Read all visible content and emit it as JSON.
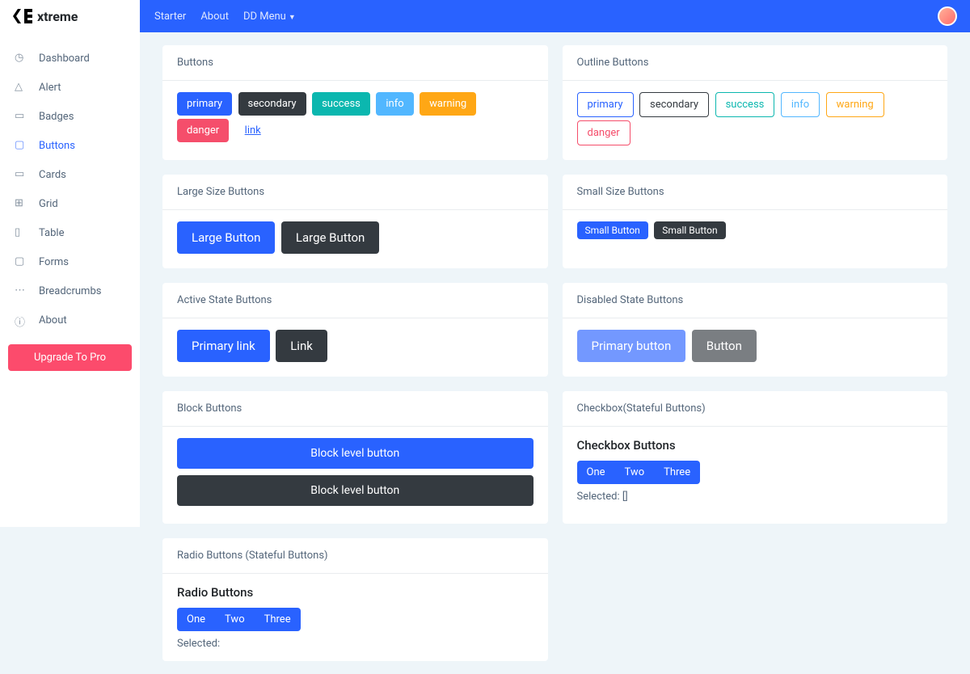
{
  "brand": "xtreme",
  "nav": [
    "Starter",
    "About",
    "DD Menu"
  ],
  "sidebar": {
    "items": [
      "Dashboard",
      "Alert",
      "Badges",
      "Buttons",
      "Cards",
      "Grid",
      "Table",
      "Forms",
      "Breadcrumbs",
      "About"
    ],
    "active_index": 3,
    "upgrade": "Upgrade To Pro"
  },
  "cards": {
    "buttons": {
      "title": "Buttons",
      "items": [
        "primary",
        "secondary",
        "success",
        "info",
        "warning",
        "danger",
        "link"
      ]
    },
    "outline": {
      "title": "Outline Buttons",
      "items": [
        "primary",
        "secondary",
        "success",
        "info",
        "warning",
        "danger"
      ]
    },
    "large": {
      "title": "Large Size Buttons",
      "items": [
        "Large Button",
        "Large Button"
      ]
    },
    "small": {
      "title": "Small Size Buttons",
      "items": [
        "Small Button",
        "Small Button"
      ]
    },
    "active": {
      "title": "Active State Buttons",
      "items": [
        "Primary link",
        "Link"
      ]
    },
    "disabled": {
      "title": "Disabled State Buttons",
      "items": [
        "Primary button",
        "Button"
      ]
    },
    "block": {
      "title": "Block Buttons",
      "items": [
        "Block level button",
        "Block level button"
      ]
    },
    "checkbox": {
      "title": "Checkbox(Stateful Buttons)",
      "heading": "Checkbox Buttons",
      "items": [
        "One",
        "Two",
        "Three"
      ],
      "selected": "Selected: []"
    },
    "radio": {
      "title": "Radio Buttons (Stateful Buttons)",
      "heading": "Radio Buttons",
      "items": [
        "One",
        "Two",
        "Three"
      ],
      "selected": "Selected:"
    }
  }
}
